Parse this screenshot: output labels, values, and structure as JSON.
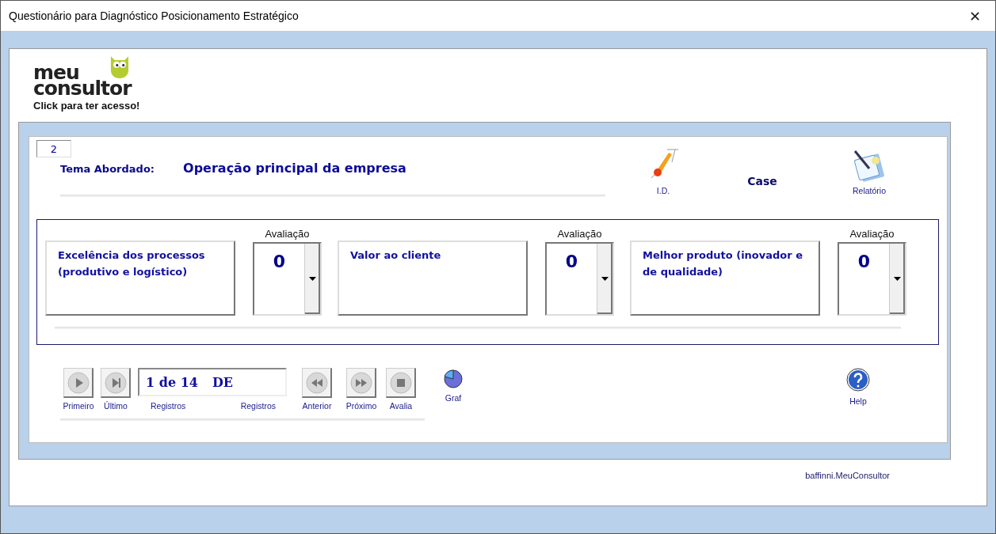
{
  "window": {
    "title": "Questionário para Diagnóstico Posicionamento Estratégico",
    "close": "✕"
  },
  "logo": {
    "line_1": "meu",
    "line_2": "consultor",
    "caption": "Click para ter acesso!"
  },
  "record_id": "2",
  "topic": {
    "label": "Tema Abordado:",
    "value": "Operação principal da empresa"
  },
  "actions": [
    {
      "kind": "id",
      "label": "I.D."
    },
    {
      "kind": "text",
      "label": "Case"
    },
    {
      "kind": "report",
      "label": "Relatório"
    }
  ],
  "criteria": [
    {
      "description": "Excelência dos processos (produtivo e logístico)",
      "rating_label": "Avaliação",
      "rating": "0"
    },
    {
      "description": "Valor ao cliente",
      "rating_label": "Avaliação",
      "rating": "0"
    },
    {
      "description": "Melhor produto (inovador e de qualidade)",
      "rating_label": "Avaliação",
      "rating": "0"
    }
  ],
  "navigation": {
    "first": "Primeiro",
    "last": "Último",
    "position": "1 de 14",
    "position_suffix": "DE",
    "records_left": "Registros",
    "records_right": "Registros",
    "previous": "Anterior",
    "next": "Próximo",
    "evaluate": "Avalia",
    "chart": "Graf",
    "help": "Help"
  },
  "footer": "baffinni.MeuConsultor"
}
